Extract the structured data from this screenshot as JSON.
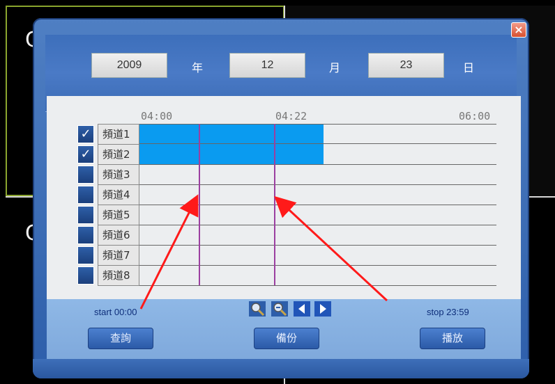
{
  "date": {
    "year_value": "2009",
    "year_label": "年",
    "month_value": "12",
    "month_label": "月",
    "day_value": "23",
    "day_label": "日"
  },
  "timeline": {
    "ticks": [
      "04:00",
      "04:22",
      "06:00"
    ]
  },
  "channels": [
    {
      "label": "頻道1",
      "checked": true,
      "check_glyph": "✓"
    },
    {
      "label": "頻道2",
      "checked": true,
      "check_glyph": "✓"
    },
    {
      "label": "頻道3",
      "checked": false,
      "check_glyph": ""
    },
    {
      "label": "頻道4",
      "checked": false,
      "check_glyph": ""
    },
    {
      "label": "頻道5",
      "checked": false,
      "check_glyph": ""
    },
    {
      "label": "頻道6",
      "checked": false,
      "check_glyph": ""
    },
    {
      "label": "頻道7",
      "checked": false,
      "check_glyph": ""
    },
    {
      "label": "頻道8",
      "checked": false,
      "check_glyph": ""
    }
  ],
  "footer": {
    "start_text": "start 00:00",
    "stop_text": "stop 23:59",
    "query_label": "查詢",
    "backup_label": "備份",
    "play_label": "播放"
  },
  "icons": [
    "zoom-in-icon",
    "zoom-out-icon",
    "arrow-left-icon",
    "arrow-right-icon",
    "close-icon"
  ],
  "background_letters": [
    "C",
    "C"
  ],
  "colors": {
    "record_bar": "#0a9bf0",
    "marker_line": "#9b3fa0",
    "annotation_arrow": "#ff0000",
    "dialog_blue": "#3d6fbb"
  }
}
